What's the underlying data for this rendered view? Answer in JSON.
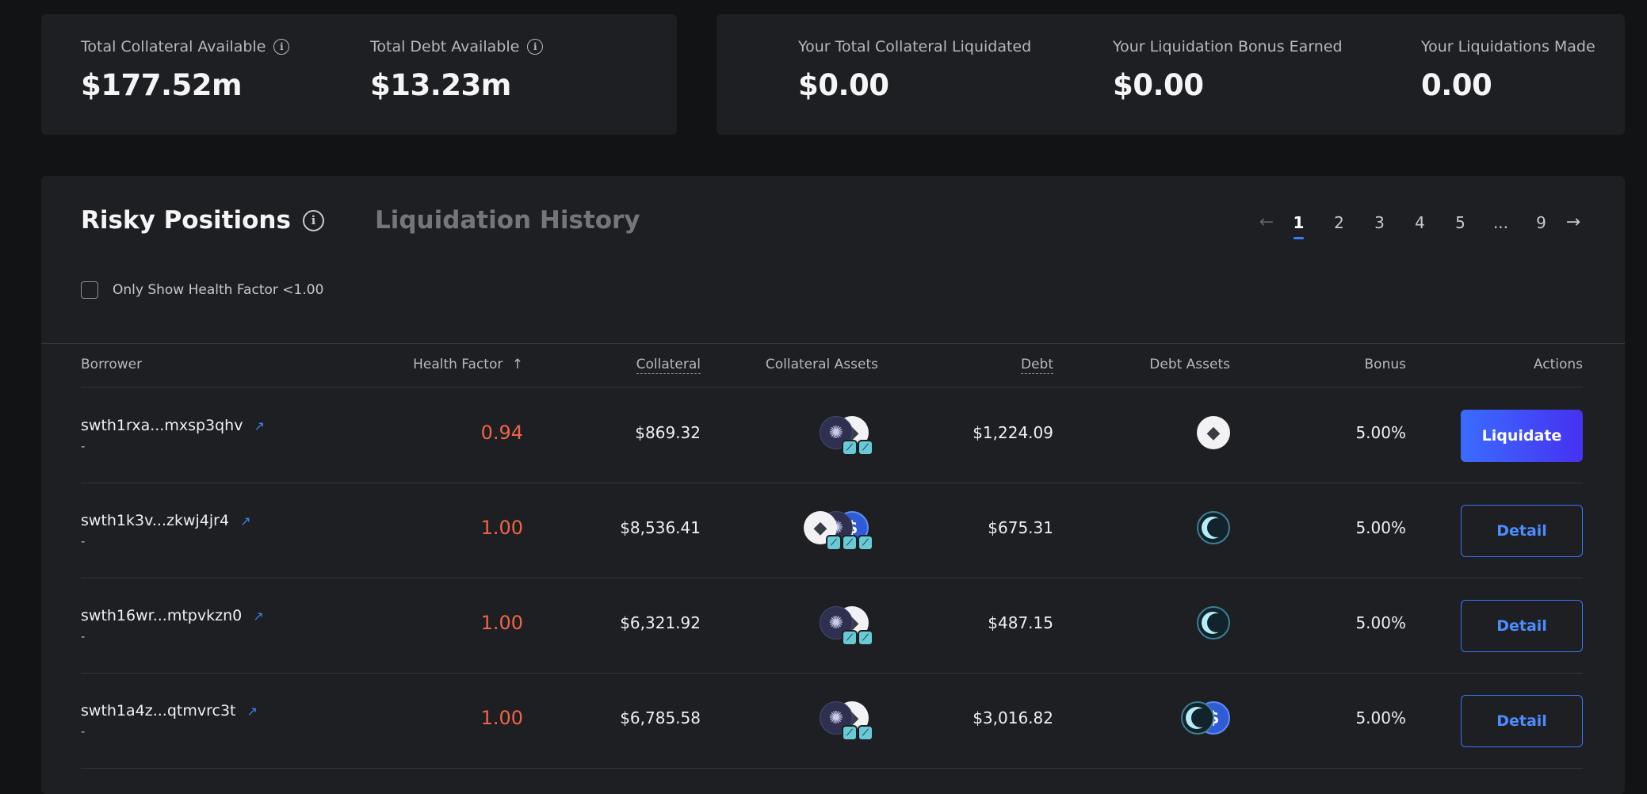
{
  "stats_left": {
    "total_collateral_label": "Total Collateral Available",
    "total_collateral_value": "$177.52m",
    "total_debt_label": "Total Debt Available",
    "total_debt_value": "$13.23m"
  },
  "stats_right": {
    "collateral_liquidated_label": "Your Total Collateral Liquidated",
    "collateral_liquidated_value": "$0.00",
    "bonus_earned_label": "Your Liquidation Bonus Earned",
    "bonus_earned_value": "$0.00",
    "liquidations_made_label": "Your Liquidations Made",
    "liquidations_made_value": "0.00"
  },
  "tabs": {
    "risky_positions": "Risky Positions",
    "liquidation_history": "Liquidation History"
  },
  "pagination": {
    "prev": "←",
    "next": "→",
    "pages": [
      "1",
      "2",
      "3",
      "4",
      "5",
      "...",
      "9"
    ],
    "current": "1"
  },
  "filter": {
    "label": "Only Show Health Factor <1.00",
    "checked": false
  },
  "table": {
    "headers": {
      "borrower": "Borrower",
      "health_factor": "Health Factor",
      "sort_icon": "↑",
      "collateral": "Collateral",
      "collateral_assets": "Collateral Assets",
      "debt": "Debt",
      "debt_assets": "Debt Assets",
      "bonus": "Bonus",
      "actions": "Actions"
    },
    "rows": [
      {
        "borrower": "swth1rxa...mxsp3qhv",
        "sub": "-",
        "health_factor": "0.94",
        "collateral": "$869.32",
        "collateral_assets": [
          "atom",
          "eth"
        ],
        "debt": "$1,224.09",
        "debt_assets": [
          "eth"
        ],
        "bonus": "5.00%",
        "action": "Liquidate"
      },
      {
        "borrower": "swth1k3v...zkwj4jr4",
        "sub": "-",
        "health_factor": "1.00",
        "collateral": "$8,536.41",
        "collateral_assets": [
          "eth",
          "atom",
          "usdc"
        ],
        "debt": "$675.31",
        "debt_assets": [
          "crescent"
        ],
        "bonus": "5.00%",
        "action": "Detail"
      },
      {
        "borrower": "swth16wr...mtpvkzn0",
        "sub": "-",
        "health_factor": "1.00",
        "collateral": "$6,321.92",
        "collateral_assets": [
          "atom",
          "eth"
        ],
        "debt": "$487.15",
        "debt_assets": [
          "crescent"
        ],
        "bonus": "5.00%",
        "action": "Detail"
      },
      {
        "borrower": "swth1a4z...qtmvrc3t",
        "sub": "-",
        "health_factor": "1.00",
        "collateral": "$6,785.58",
        "collateral_assets": [
          "atom",
          "eth"
        ],
        "debt": "$3,016.82",
        "debt_assets": [
          "crescent",
          "usdc"
        ],
        "bonus": "5.00%",
        "action": "Detail"
      }
    ]
  },
  "icons": {
    "info": "info-icon",
    "external_link": "external-link-icon",
    "ext_glyph": "↗",
    "info_glyph": "i"
  },
  "colors": {
    "background": "#121315",
    "card": "#1e1f22",
    "accent_blue": "#3a6cff",
    "danger_red": "#f0634a"
  }
}
